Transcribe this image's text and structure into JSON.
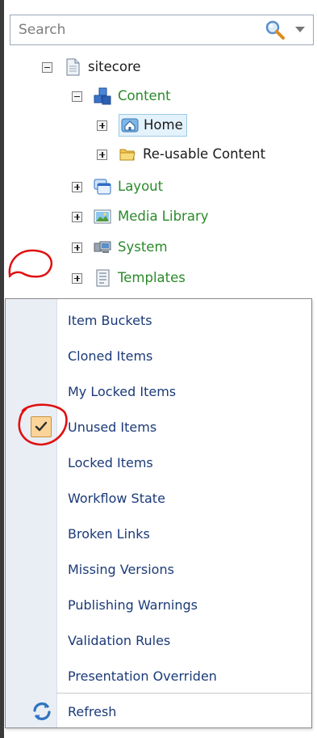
{
  "search": {
    "placeholder": "Search"
  },
  "tree": {
    "items": [
      {
        "label": "sitecore",
        "expander": "minus",
        "icon": "document-icon",
        "green": false
      },
      {
        "label": "Content",
        "expander": "minus",
        "icon": "content-cubes-icon",
        "green": true
      },
      {
        "label": "Home",
        "expander": "plus",
        "icon": "home-icon",
        "green": false,
        "selected": true
      },
      {
        "label": "Re-usable Content",
        "expander": "plus",
        "icon": "folder-icon",
        "green": false
      },
      {
        "label": "Layout",
        "expander": "plus",
        "icon": "layout-windows-icon",
        "green": true
      },
      {
        "label": "Media Library",
        "expander": "plus",
        "icon": "picture-icon",
        "green": true
      },
      {
        "label": "System",
        "expander": "plus",
        "icon": "system-computer-icon",
        "green": true
      },
      {
        "label": "Templates",
        "expander": "plus",
        "icon": "template-document-icon",
        "green": true
      }
    ]
  },
  "menu": {
    "items": [
      {
        "label": "Item Buckets",
        "checked": false
      },
      {
        "label": "Cloned Items",
        "checked": false
      },
      {
        "label": "My Locked Items",
        "checked": false
      },
      {
        "label": "Unused Items",
        "checked": true
      },
      {
        "label": "Locked Items",
        "checked": false
      },
      {
        "label": "Workflow State",
        "checked": false
      },
      {
        "label": "Broken Links",
        "checked": false
      },
      {
        "label": "Missing Versions",
        "checked": false
      },
      {
        "label": "Publishing Warnings",
        "checked": false
      },
      {
        "label": "Validation Rules",
        "checked": false
      },
      {
        "label": "Presentation Overriden",
        "checked": false
      }
    ],
    "refresh_label": "Refresh"
  },
  "colors": {
    "green_text": "#2a8a2a",
    "menu_text": "#1b3a78",
    "annotation_red": "#e01010",
    "check_fill": "#fbd49a"
  }
}
